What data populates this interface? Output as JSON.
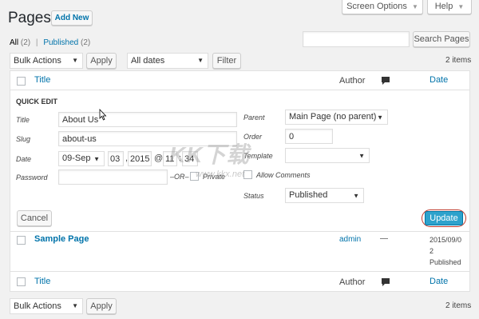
{
  "header": {
    "title": "Pages",
    "add_new": "Add New",
    "screen_options": "Screen Options",
    "help": "Help"
  },
  "filters": {
    "all": "All",
    "all_count": "(2)",
    "separator": "|",
    "published": "Published",
    "published_count": "(2)",
    "search_button": "Search Pages",
    "search_placeholder": ""
  },
  "top_actions": {
    "bulk_actions": "Bulk Actions",
    "apply": "Apply",
    "all_dates": "All dates",
    "filter": "Filter",
    "items": "2 items"
  },
  "table": {
    "col_title": "Title",
    "col_author": "Author",
    "col_date": "Date"
  },
  "quick_edit": {
    "heading": "QUICK EDIT",
    "title_label": "Title",
    "title_value": "About Us",
    "slug_label": "Slug",
    "slug_value": "about-us",
    "date_label": "Date",
    "date_month": "09-Sep",
    "date_day": "03",
    "date_year": "2015",
    "date_at": "@",
    "date_hour": "11",
    "date_colon": ":",
    "date_min": "34",
    "password_label": "Password",
    "or_text": "–OR–",
    "private_label": "Private",
    "parent_label": "Parent",
    "parent_value": "Main Page (no parent)",
    "order_label": "Order",
    "order_value": "0",
    "template_label": "Template",
    "allow_comments": "Allow Comments",
    "status_label": "Status",
    "status_value": "Published",
    "cancel": "Cancel",
    "update": "Update"
  },
  "row": {
    "title": "Sample Page",
    "author": "admin",
    "comments": "—",
    "date_line1": "2015/09/0",
    "date_line2": "2",
    "date_status": "Published"
  },
  "bottom_actions": {
    "bulk_actions": "Bulk Actions",
    "apply": "Apply",
    "items": "2 items"
  },
  "watermark": {
    "text": "KK下载",
    "url": "www.kkx.net"
  }
}
